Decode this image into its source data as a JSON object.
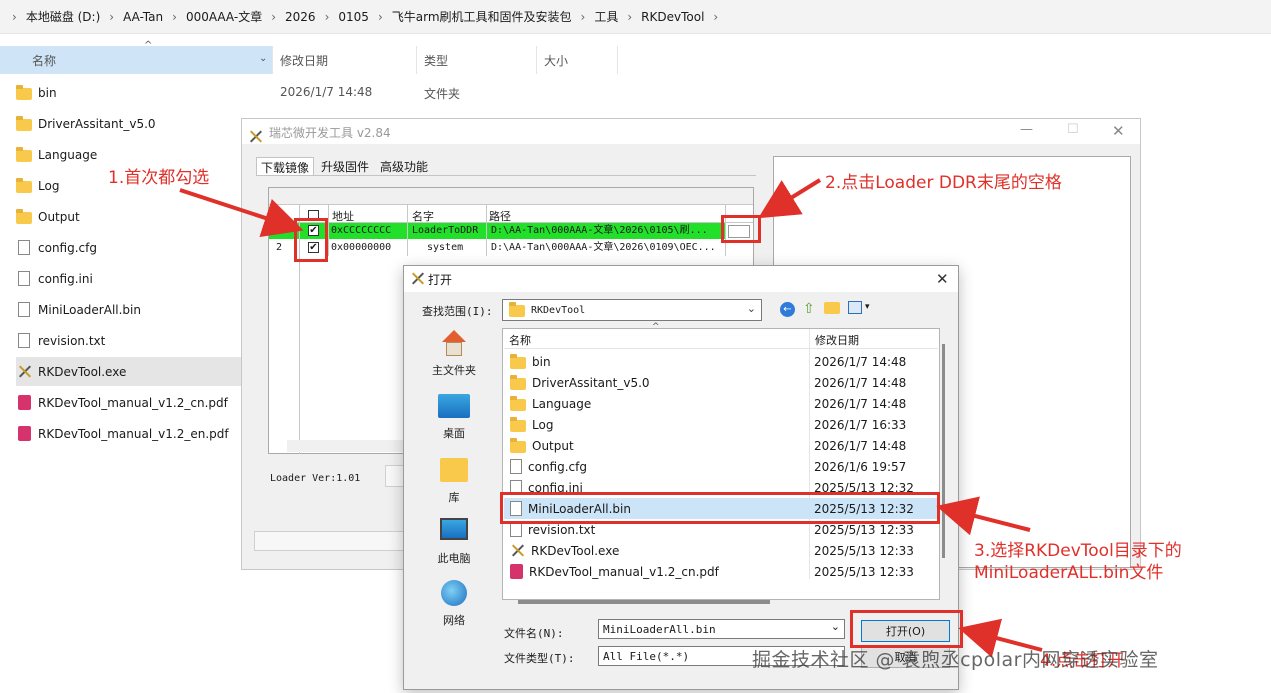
{
  "breadcrumb": [
    "本地磁盘 (D:)",
    "AA-Tan",
    "000AAA-文章",
    "2026",
    "0105",
    "飞牛arm刷机工具和固件及安装包",
    "工具",
    "RKDevTool"
  ],
  "explorer": {
    "columns": [
      "名称",
      "修改日期",
      "类型",
      "大小"
    ],
    "files": [
      {
        "name": "bin",
        "kind": "folder",
        "date": "2026/1/7 14:48",
        "type": "文件夹"
      },
      {
        "name": "DriverAssitant_v5.0",
        "kind": "folder"
      },
      {
        "name": "Language",
        "kind": "folder"
      },
      {
        "name": "Log",
        "kind": "folder"
      },
      {
        "name": "Output",
        "kind": "folder"
      },
      {
        "name": "config.cfg",
        "kind": "doc"
      },
      {
        "name": "config.ini",
        "kind": "doc"
      },
      {
        "name": "MiniLoaderAll.bin",
        "kind": "doc"
      },
      {
        "name": "revision.txt",
        "kind": "doc"
      },
      {
        "name": "RKDevTool.exe",
        "kind": "exe"
      },
      {
        "name": "RKDevTool_manual_v1.2_cn.pdf",
        "kind": "pdf"
      },
      {
        "name": "RKDevTool_manual_v1.2_en.pdf",
        "kind": "pdf"
      }
    ]
  },
  "rktool": {
    "title": "瑞芯微开发工具 v2.84",
    "tabs": [
      "下载镜像",
      "升级固件",
      "高级功能"
    ],
    "table_headers": [
      "#",
      "地址",
      "名字",
      "路径"
    ],
    "rows": [
      {
        "num": "1",
        "address": "0xCCCCCCCC",
        "name": "LoaderToDDR",
        "path": "D:\\AA-Tan\\000AAA-文章\\2026\\0105\\刷..."
      },
      {
        "num": "2",
        "address": "0x00000000",
        "name": "system",
        "path": "D:\\AA-Tan\\000AAA-文章\\2026\\0109\\OEC..."
      }
    ],
    "loader_ver": "Loader Ver:1.01"
  },
  "dialog": {
    "title": "打开",
    "lookin_label": "查找范围(I):",
    "lookin_value": "RKDevTool",
    "places": [
      "主文件夹",
      "桌面",
      "库",
      "此电脑",
      "网络"
    ],
    "list_headers": [
      "名称",
      "修改日期"
    ],
    "files": [
      {
        "name": "bin",
        "kind": "folder",
        "date": "2026/1/7 14:48"
      },
      {
        "name": "DriverAssitant_v5.0",
        "kind": "folder",
        "date": "2026/1/7 14:48"
      },
      {
        "name": "Language",
        "kind": "folder",
        "date": "2026/1/7 14:48"
      },
      {
        "name": "Log",
        "kind": "folder",
        "date": "2026/1/7 16:33"
      },
      {
        "name": "Output",
        "kind": "folder",
        "date": "2026/1/7 14:48"
      },
      {
        "name": "config.cfg",
        "kind": "doc",
        "date": "2026/1/6 19:57"
      },
      {
        "name": "config.ini",
        "kind": "doc",
        "date": "2025/5/13 12:32"
      },
      {
        "name": "MiniLoaderAll.bin",
        "kind": "doc",
        "date": "2025/5/13 12:32"
      },
      {
        "name": "revision.txt",
        "kind": "doc",
        "date": "2025/5/13 12:33"
      },
      {
        "name": "RKDevTool.exe",
        "kind": "exe",
        "date": "2025/5/13 12:33"
      },
      {
        "name": "RKDevTool_manual_v1.2_cn.pdf",
        "kind": "pdf",
        "date": "2025/5/13 12:33"
      },
      {
        "name": "RKDevTool_manual_v1.2_en.pdf",
        "kind": "pdf",
        "date": "2025/5/13 12:33"
      }
    ],
    "filename_label": "文件名(N):",
    "filename_value": "MiniLoaderAll.bin",
    "filetype_label": "文件类型(T):",
    "filetype_value": "All File(*.*)",
    "open_button": "打开(O)",
    "cancel_button": "取消"
  },
  "annotations": {
    "a1": "1.首次都勾选",
    "a2": "2.点击Loader DDR末尾的空格",
    "a3_line1": "3.选择RKDevTool目录下的",
    "a3_line2": "MiniLoaderALL.bin文件",
    "a4": "4.点击打开"
  },
  "watermark": "掘金技术社区 @ 袁煦丞cpolar内网穿透实验室",
  "colors": {
    "annotation_red": "#e0302a",
    "row_green": "#22e02a",
    "selection_blue": "#cce4f7"
  }
}
